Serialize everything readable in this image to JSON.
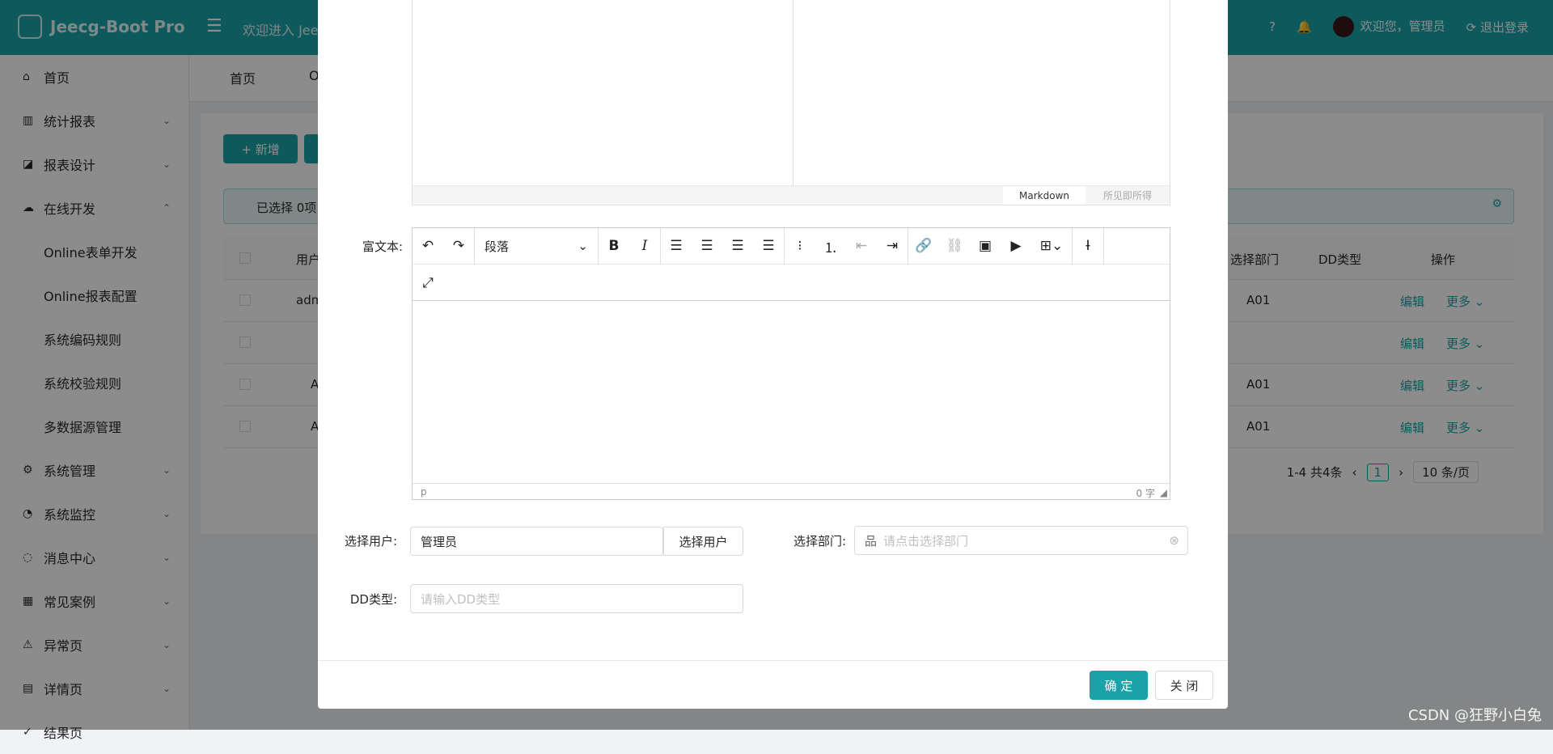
{
  "header": {
    "app_title": "Jeecg-Boot Pro",
    "welcome_text": "欢迎进入 Jee",
    "user_text": "欢迎您，管理员",
    "logout_text": "退出登录"
  },
  "sidebar": {
    "items": [
      {
        "label": "首页"
      },
      {
        "label": "统计报表"
      },
      {
        "label": "报表设计"
      },
      {
        "label": "在线开发"
      },
      {
        "label": "Online表单开发"
      },
      {
        "label": "Online报表配置"
      },
      {
        "label": "系统编码规则"
      },
      {
        "label": "系统校验规则"
      },
      {
        "label": "多数据源管理"
      },
      {
        "label": "系统管理"
      },
      {
        "label": "系统监控"
      },
      {
        "label": "消息中心"
      },
      {
        "label": "常见案例"
      },
      {
        "label": "异常页"
      },
      {
        "label": "详情页"
      },
      {
        "label": "结果页"
      }
    ]
  },
  "tabs": {
    "home": "首页",
    "second": "O"
  },
  "toolbar": {
    "add_label": "+ 新增"
  },
  "alert": {
    "text": "已选择 0项"
  },
  "table": {
    "headers": {
      "user": "用户",
      "dept": "选择部门",
      "dd": "DD类型",
      "op": "操作"
    },
    "rows": [
      {
        "user": "adm",
        "dept": "A01",
        "edit": "编辑",
        "more": "更多 ⌄"
      },
      {
        "user": "",
        "dept": "",
        "edit": "编辑",
        "more": "更多 ⌄"
      },
      {
        "user": "A",
        "dept": "A01",
        "edit": "编辑",
        "more": "更多 ⌄"
      },
      {
        "user": "A",
        "dept": "A01",
        "edit": "编辑",
        "more": "更多 ⌄"
      }
    ],
    "pager": {
      "total": "1-4 共4条",
      "page": "1",
      "size": "10 条/页"
    }
  },
  "modal": {
    "md_tab_markdown": "Markdown",
    "md_tab_wysiwyg": "所见即所得",
    "richtext_label": "富文本:",
    "paragraph": "段落",
    "status_tag": "p",
    "word_count": "0 字",
    "user_label": "选择用户:",
    "user_value": "管理员",
    "user_button": "选择用户",
    "dept_label": "选择部门:",
    "dept_placeholder": "请点击选择部门",
    "dd_label": "DD类型:",
    "dd_placeholder": "请输入DD类型",
    "ok": "确 定",
    "close": "关 闭"
  },
  "watermark": "CSDN @狂野小白兔",
  "colors": {
    "primary": "#1aa2a8"
  }
}
